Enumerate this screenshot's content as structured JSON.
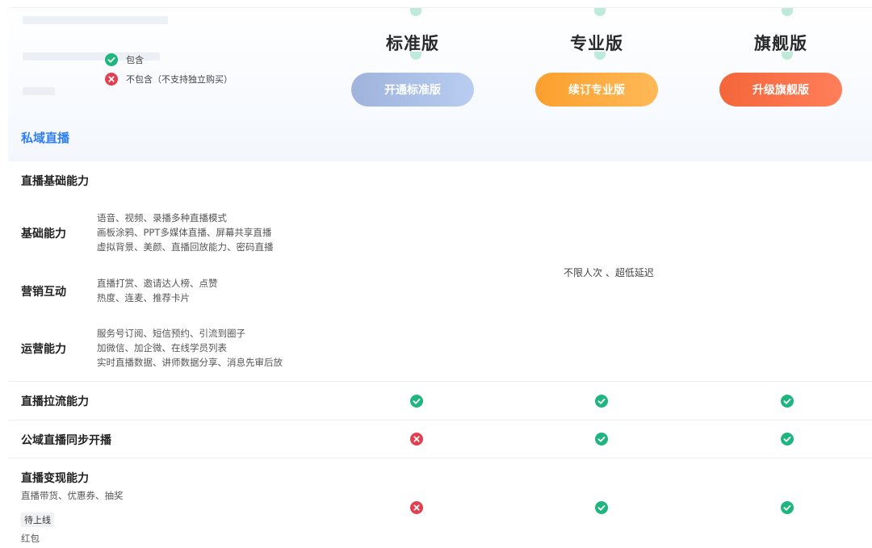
{
  "legend": {
    "included": "包含",
    "excluded": "不包含（不支持独立购买）"
  },
  "plans": [
    {
      "title": "标准版",
      "button": "开通标准版"
    },
    {
      "title": "专业版",
      "button": "续订专业版"
    },
    {
      "title": "旗舰版",
      "button": "升级旗舰版"
    }
  ],
  "colors": {
    "section_blue": "#2f7ef5",
    "check_green": "#1fb57f",
    "cross_red": "#e0404f"
  },
  "section": {
    "title": "私域直播"
  },
  "group": {
    "title": "直播基础能力"
  },
  "features": [
    {
      "name": "基础能力",
      "desc": [
        "语音、视频、录播多种直播模式",
        "画板涂鸦、PPT多媒体直播、屏幕共享直播",
        "虚拟背景、美颜、直播回放能力、密码直播"
      ]
    },
    {
      "name": "营销互动",
      "desc": [
        "直播打赏、邀请达人榜、点赞",
        "热度、连麦、推荐卡片"
      ]
    },
    {
      "name": "运营能力",
      "desc": [
        "服务号订阅、短信预约、引流到圈子",
        "加微信、加企微、在线学员列表",
        "实时直播数据、讲师数据分享、消息先审后放"
      ]
    }
  ],
  "merged_note": "不限人次 、超低延迟",
  "rows": [
    {
      "name": "直播拉流能力",
      "std": "check-icon",
      "pro": "check-icon",
      "flag": "check-icon"
    },
    {
      "name": "公域直播同步开播",
      "std": "cross-icon",
      "pro": "check-icon",
      "flag": "check-icon"
    },
    {
      "name": "直播变现能力",
      "sub": "直播带货、优惠券、抽奖",
      "tag": "待上线",
      "tag_sub": "红包",
      "std": "cross-icon",
      "pro": "check-icon",
      "flag": "check-icon"
    }
  ]
}
